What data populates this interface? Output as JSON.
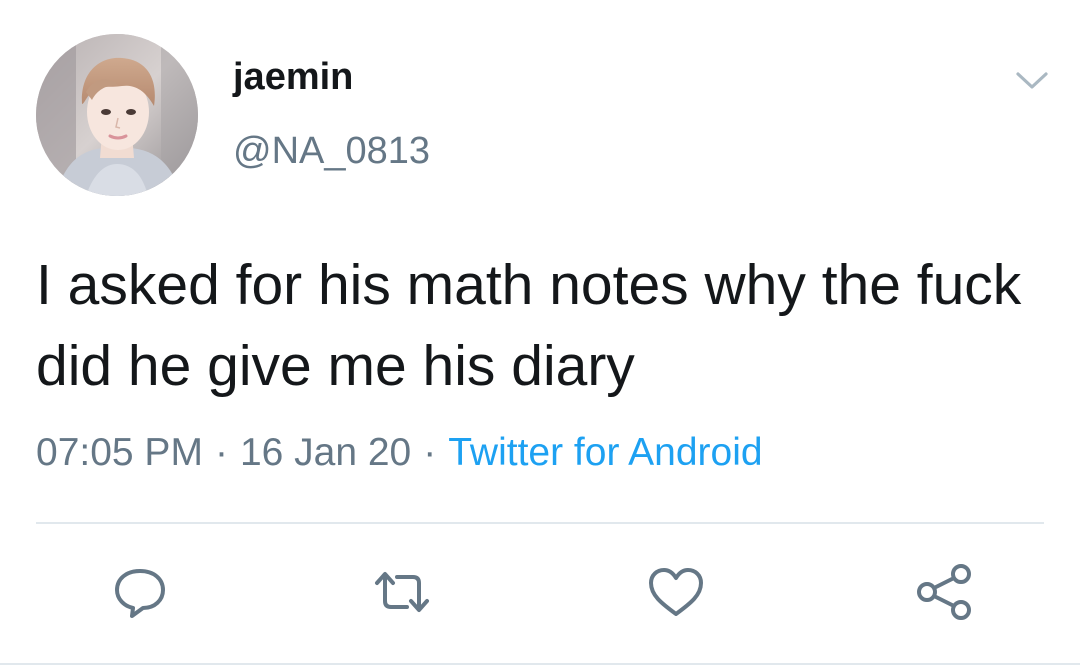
{
  "author": {
    "display_name": "jaemin",
    "handle": "@NA_0813",
    "avatar_icon": "profile-photo"
  },
  "tweet": {
    "text": "I asked for his math notes why the fuck did he give me his diary",
    "time": "07:05 PM",
    "date": "16 Jan 20",
    "separator": "·",
    "source": "Twitter for Android"
  },
  "actions": [
    {
      "name": "reply",
      "icon": "comment-icon"
    },
    {
      "name": "retweet",
      "icon": "retweet-icon"
    },
    {
      "name": "like",
      "icon": "heart-icon"
    },
    {
      "name": "share",
      "icon": "share-icon"
    }
  ],
  "colors": {
    "text": "#14171a",
    "secondary": "#657786",
    "link": "#1da1f2",
    "divider": "#e1e8ed"
  }
}
